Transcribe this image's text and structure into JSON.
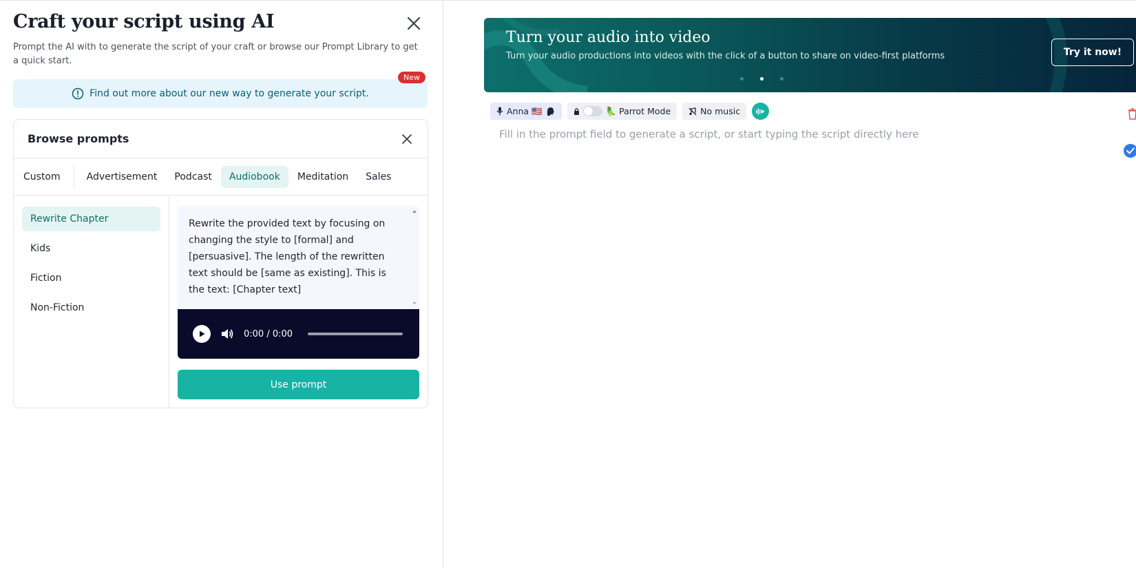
{
  "panel": {
    "title": "Craft your script using AI",
    "subtitle": "Prompt the AI with to generate the script of your craft or browse our Prompt Library to get a quick start.",
    "info_banner": "Find out more about our new way to generate your script.",
    "new_badge": "New"
  },
  "browse": {
    "title": "Browse prompts",
    "tabs": [
      "Custom",
      "Advertisement",
      "Podcast",
      "Audiobook",
      "Meditation",
      "Sales"
    ],
    "active_tab": "Audiobook",
    "categories": [
      "Rewrite Chapter",
      "Kids",
      "Fiction",
      "Non-Fiction"
    ],
    "active_category": "Rewrite Chapter",
    "prompt_text": "Rewrite the provided text by focusing on changing the style to [formal] and [persuasive]. The length of the rewritten text should be [same as existing]. This is the text: [Chapter text]",
    "player": {
      "time": "0:00 / 0:00",
      "progress": 0
    },
    "use_button": "Use prompt"
  },
  "hero": {
    "title": "Turn your audio into video",
    "subtitle": "Turn your audio productions into videos with the click of a button to share on video-first platforms",
    "cta": "Try it now!",
    "slide_count": 3,
    "active_slide": 1
  },
  "toolbar": {
    "voice": "Anna 🇺🇸",
    "parrot_mode": "🦜 Parrot Mode",
    "music": "No music"
  },
  "editor": {
    "placeholder": "Fill in the prompt field to generate a script, or start typing the script directly here"
  },
  "colors": {
    "accent": "#17b3a5",
    "active_tab_bg": "#e4f4f2",
    "active_tab_text": "#0d6f66",
    "badge_red": "#d93030",
    "player_bg": "#0a0b2a"
  }
}
